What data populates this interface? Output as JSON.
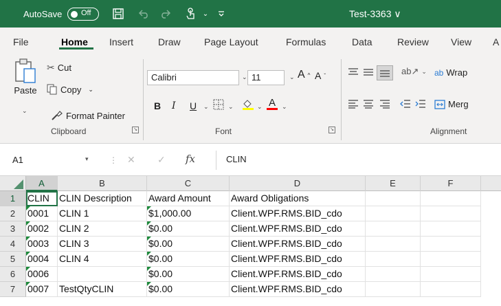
{
  "titlebar": {
    "autosave_label": "AutoSave",
    "autosave_state": "Off",
    "document_title": "Test-3363 ∨",
    "accent_color": "#217346"
  },
  "tabs": [
    {
      "label": "File",
      "active": false
    },
    {
      "label": "Home",
      "active": true
    },
    {
      "label": "Insert",
      "active": false
    },
    {
      "label": "Draw",
      "active": false
    },
    {
      "label": "Page Layout",
      "active": false
    },
    {
      "label": "Formulas",
      "active": false
    },
    {
      "label": "Data",
      "active": false
    },
    {
      "label": "Review",
      "active": false
    },
    {
      "label": "View",
      "active": false
    },
    {
      "label": "A",
      "active": false
    }
  ],
  "clipboard": {
    "paste": "Paste",
    "cut": "Cut",
    "copy": "Copy",
    "format_painter": "Format Painter",
    "group_label": "Clipboard"
  },
  "font": {
    "name": "Calibri",
    "size": "11",
    "group_label": "Font"
  },
  "alignment": {
    "wrap": "Wrap",
    "merge": "Merg",
    "group_label": "Alignment"
  },
  "formula_bar": {
    "name_box": "A1",
    "fx": "fx",
    "value": "CLIN"
  },
  "grid": {
    "columns": [
      "A",
      "B",
      "C",
      "D",
      "E",
      "F"
    ],
    "rows": [
      {
        "num": "1",
        "cells": [
          "CLIN",
          "CLIN Description",
          "Award Amount",
          "Award Obligations",
          "",
          ""
        ]
      },
      {
        "num": "2",
        "cells": [
          "0001",
          "CLIN 1",
          "$1,000.00",
          "Client.WPF.RMS.BID_cdo",
          "",
          ""
        ]
      },
      {
        "num": "3",
        "cells": [
          "0002",
          "CLIN 2",
          "$0.00",
          "Client.WPF.RMS.BID_cdo",
          "",
          ""
        ]
      },
      {
        "num": "4",
        "cells": [
          "0003",
          "CLIN 3",
          "$0.00",
          "Client.WPF.RMS.BID_cdo",
          "",
          ""
        ]
      },
      {
        "num": "5",
        "cells": [
          "0004",
          "CLIN 4",
          "$0.00",
          "Client.WPF.RMS.BID_cdo",
          "",
          ""
        ]
      },
      {
        "num": "6",
        "cells": [
          "0006",
          "",
          "$0.00",
          "Client.WPF.RMS.BID_cdo",
          "",
          ""
        ]
      },
      {
        "num": "7",
        "cells": [
          "0007",
          "TestQtyCLIN",
          "$0.00",
          "Client.WPF.RMS.BID_cdo",
          "",
          ""
        ]
      }
    ]
  }
}
